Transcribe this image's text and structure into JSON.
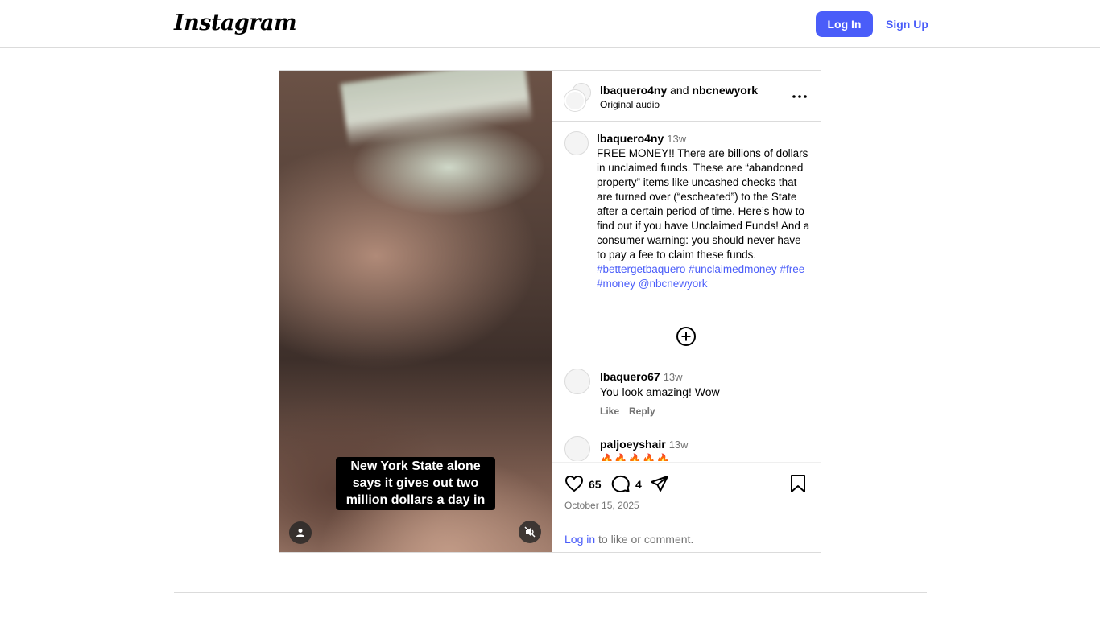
{
  "header": {
    "logo": "Instagram",
    "login_label": "Log In",
    "signup_label": "Sign Up",
    "accent_color": "#4a5df9"
  },
  "post": {
    "media": {
      "video_caption_line1": "New York State alone",
      "video_caption_line2": "says it gives out two",
      "video_caption_line3": "million dollars a day in",
      "user_tag_icon": "user-icon",
      "mute_icon": "muted-speaker-icon"
    },
    "author_header": {
      "author1": "lbaquero4ny",
      "joiner": "and",
      "author2": "nbcnewyork",
      "audio": "Original audio",
      "more_icon": "more-dots-icon"
    },
    "caption": {
      "username": "lbaquero4ny",
      "time": "13w",
      "text": "FREE MONEY!! There are billions of dollars in unclaimed funds. These are “abandoned property” items like uncashed checks that are turned over (“escheated”) to the State after a certain period of time. Here’s how to find out if you have Unclaimed Funds! And a consumer warning: you should never have to pay a fee to claim these funds.",
      "tag1": "#bettergetbaquero",
      "tag2": "#unclaimedmoney",
      "tag3": "#free",
      "tag4": "#money",
      "mention": "@nbcnewyork"
    },
    "load_more_icon": "plus-circle-icon",
    "comments": [
      {
        "username": "lbaquero67",
        "time": "13w",
        "text": "You look amazing! Wow",
        "like_label": "Like",
        "reply_label": "Reply"
      },
      {
        "username": "paljoeyshair",
        "time": "13w",
        "text": "🔥🔥🔥🔥🔥"
      }
    ],
    "actions": {
      "likes": "65",
      "comments_count": "4",
      "date": "October 15, 2025",
      "login_link": "Log in",
      "login_suffix": " to like or comment."
    }
  }
}
